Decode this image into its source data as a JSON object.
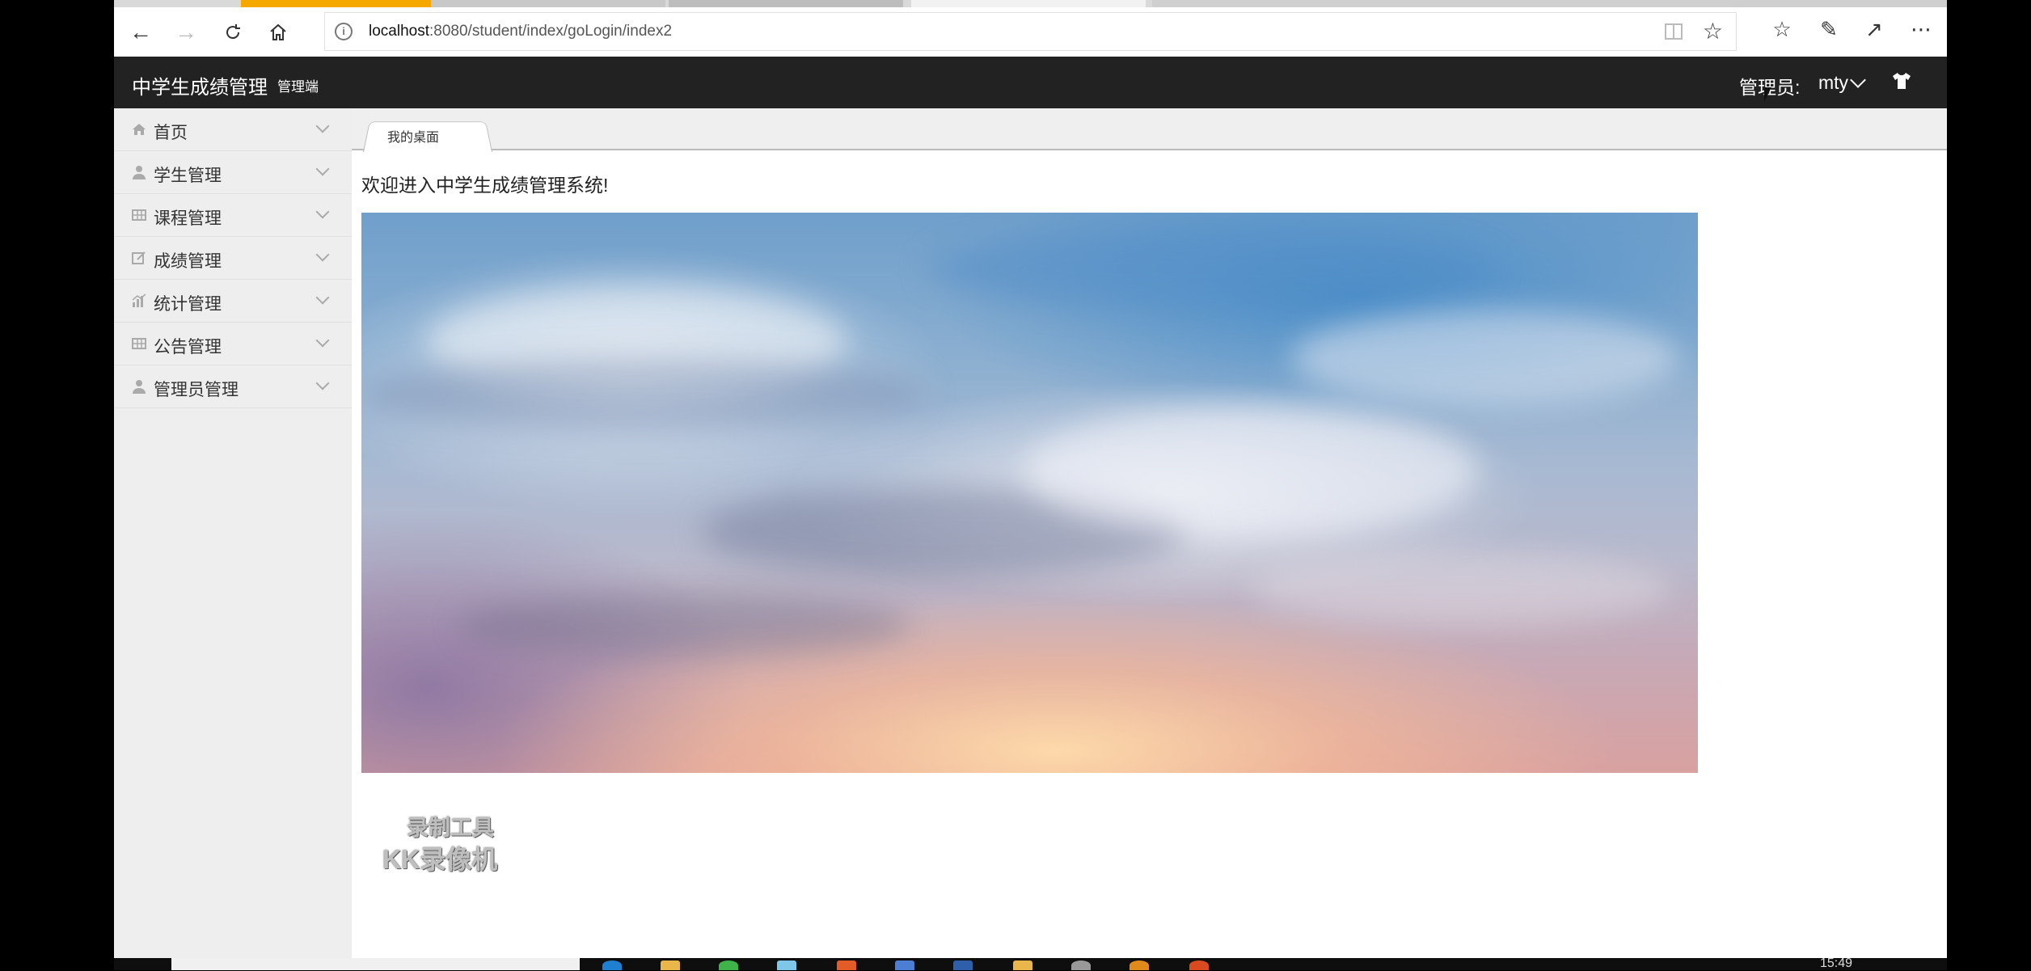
{
  "browser": {
    "url_host": "localhost",
    "url_rest": ":8080/student/index/goLogin/index2"
  },
  "header": {
    "title": "中学生成绩管理",
    "subtitle": "管理端",
    "admin_label": "管理员:",
    "username": "mty"
  },
  "sidebar": {
    "items": [
      {
        "label": "首页",
        "icon": "home-icon"
      },
      {
        "label": "学生管理",
        "icon": "user-icon"
      },
      {
        "label": "课程管理",
        "icon": "grid-icon"
      },
      {
        "label": "成绩管理",
        "icon": "edit-icon"
      },
      {
        "label": "统计管理",
        "icon": "chart-icon"
      },
      {
        "label": "公告管理",
        "icon": "grid-icon"
      },
      {
        "label": "管理员管理",
        "icon": "user-icon"
      }
    ]
  },
  "main": {
    "tab_label": "我的桌面",
    "welcome": "欢迎进入中学生成绩管理系统!"
  },
  "watermark": {
    "line1": "录制工具",
    "line2": "KK录像机"
  },
  "taskbar": {
    "clock": "15:49"
  },
  "colors": {
    "header_bg": "#222222",
    "sidebar_bg": "#eeeeee",
    "accent_tab": "#f5a800"
  }
}
